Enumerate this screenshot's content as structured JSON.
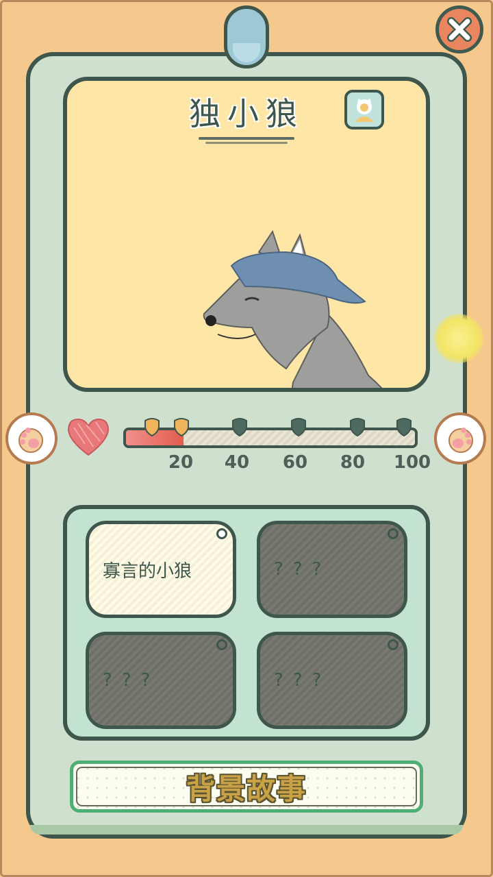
{
  "character": {
    "name": "独小狼",
    "portrait_icon": "cat-avatar-icon"
  },
  "affection": {
    "progress": 0.2,
    "ticks": [
      "20",
      "40",
      "60",
      "80",
      "100"
    ],
    "unlocked_markers": 2,
    "total_markers": 6
  },
  "traits": [
    {
      "label": "寡言的小狼",
      "locked": false
    },
    {
      "label": "???",
      "locked": true
    },
    {
      "label": "???",
      "locked": true
    },
    {
      "label": "???",
      "locked": true
    }
  ],
  "buttons": {
    "story_label": "背景故事",
    "close_icon": "close-icon",
    "prev_icon": "paw-left-icon",
    "next_icon": "paw-right-icon"
  },
  "colors": {
    "background": "#f5c98d",
    "card": "#cfe0cf",
    "outline": "#3e564c",
    "portrait_bg": "#fde6a6",
    "bar_fill": "#e45c4f"
  }
}
